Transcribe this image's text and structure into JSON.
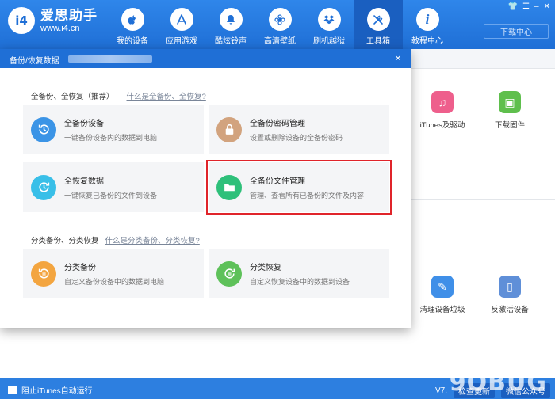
{
  "app": {
    "logo_badge": "i4",
    "name": "爱思助手",
    "url": "www.i4.cn",
    "download_center": "下载中心",
    "window_controls": [
      "👕",
      "☰",
      "–",
      "✕"
    ]
  },
  "nav": [
    {
      "label": "我的设备",
      "icon": "apple-icon"
    },
    {
      "label": "应用游戏",
      "icon": "appstore-icon"
    },
    {
      "label": "酷炫铃声",
      "icon": "bell-icon"
    },
    {
      "label": "高清壁纸",
      "icon": "flower-icon"
    },
    {
      "label": "刷机越狱",
      "icon": "dropbox-icon"
    },
    {
      "label": "工具箱",
      "icon": "tools-icon",
      "active": true
    },
    {
      "label": "教程中心",
      "icon": "info-icon"
    }
  ],
  "background_tools": {
    "itunes": "iTunes及驱动",
    "firmware": "下载固件",
    "clean": "清理设备垃圾",
    "deactivate": "反激活设备"
  },
  "bottom": {
    "itunes_block": "阻止iTunes自动运行",
    "version": "V7.",
    "check_update": "检查更新",
    "wechat": "微信公众号"
  },
  "modal": {
    "title": "备份/恢复数据",
    "close": "×",
    "section1": {
      "label": "全备份、全恢复（推荐）",
      "link": "什么是全备份、全恢复?"
    },
    "section2": {
      "label": "分类备份、分类恢复",
      "link": "什么是分类备份、分类恢复?"
    },
    "cards": {
      "full_backup": {
        "title": "全备份设备",
        "desc": "一键备份设备内的数据到电脑"
      },
      "backup_password": {
        "title": "全备份密码管理",
        "desc": "设置或删除设备的全备份密码"
      },
      "full_restore": {
        "title": "全恢复数据",
        "desc": "一键恢复已备份的文件到设备"
      },
      "backup_files": {
        "title": "全备份文件管理",
        "desc": "管理、查看所有已备份的文件及内容"
      },
      "category_backup": {
        "title": "分类备份",
        "desc": "自定义备份设备中的数据到电脑"
      },
      "category_restore": {
        "title": "分类恢复",
        "desc": "自定义恢复设备中的数据到设备"
      }
    }
  },
  "watermark": "9OBUG"
}
